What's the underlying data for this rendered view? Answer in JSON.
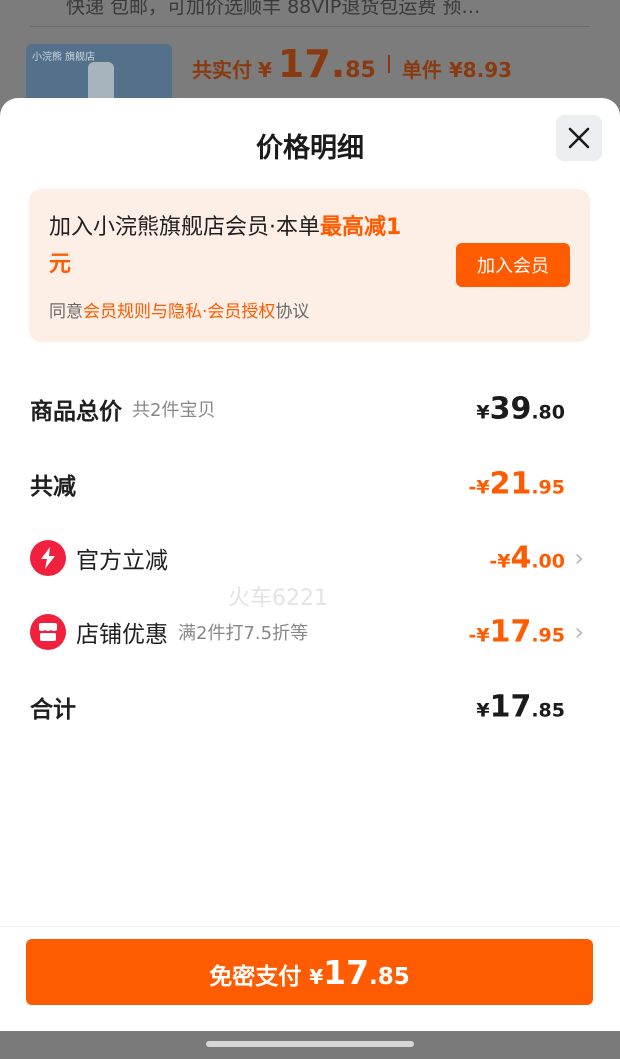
{
  "background": {
    "header_text": "快递 包邮，可加价选顺丰 88VIP退货包运费 预…",
    "thumb_label": "小浣熊 旗舰店",
    "price_label": "共实付",
    "price_currency": "¥",
    "price_int": "17.",
    "price_dec": "85",
    "unit_text": "单件 ¥8.93"
  },
  "sheet": {
    "title": "价格明细"
  },
  "banner": {
    "text_main": "加入小浣熊旗舰店会员·本单",
    "text_highlight": "最高减1元",
    "agree_prefix": "同意",
    "agree_link": "会员规则与隐私·会员授权",
    "agree_suffix": "协议",
    "join_label": "加入会员"
  },
  "rows": {
    "total": {
      "label": "商品总价",
      "sub": "共2件宝贝",
      "currency": "¥",
      "int": "39",
      "dec": ".80"
    },
    "discount": {
      "label": "共减",
      "currency": "-¥",
      "int": "21",
      "dec": ".95"
    },
    "official": {
      "label": "官方立减",
      "currency": "-¥",
      "int": "4",
      "dec": ".00"
    },
    "store": {
      "label": "店铺优惠",
      "sub": "满2件打7.5折等",
      "currency": "-¥",
      "int": "17",
      "dec": ".95"
    },
    "sum": {
      "label": "合计",
      "currency": "¥",
      "int": "17",
      "dec": ".85"
    }
  },
  "watermark": "火车6221",
  "pay_button": {
    "label": "免密支付",
    "currency": "¥",
    "int": "17",
    "dec": ".85"
  },
  "colors": {
    "accent": "#ff5b00",
    "icon_red": "#f0203f",
    "banner_bg": "#fdeee6"
  },
  "icons": {
    "close": "close-icon",
    "official": "lightning-icon",
    "store": "store-icon",
    "chevron": "chevron-right-icon"
  }
}
